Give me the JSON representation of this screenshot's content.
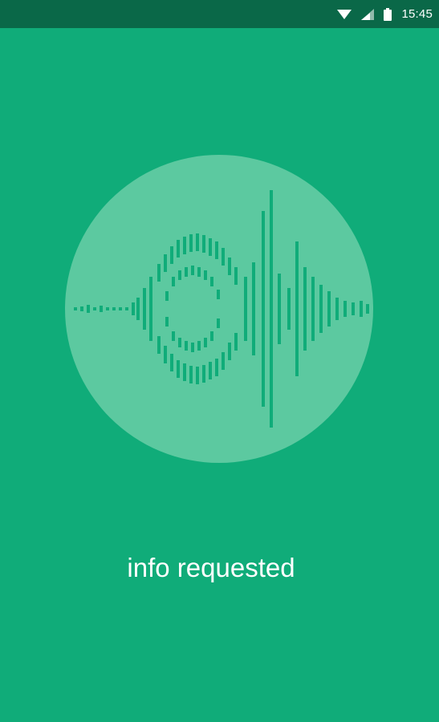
{
  "status_bar": {
    "time": "15:45",
    "icons": [
      "wifi-icon",
      "cellular-signal-icon",
      "battery-icon"
    ]
  },
  "main": {
    "logo_icon": "soundwave-eye-logo-icon",
    "status_message": "info requested"
  },
  "colors": {
    "background": "#10ac79",
    "status_bar": "#0a6848",
    "circle": "#5cc9a0",
    "wave": "#10ac79",
    "text": "#ffffff"
  }
}
